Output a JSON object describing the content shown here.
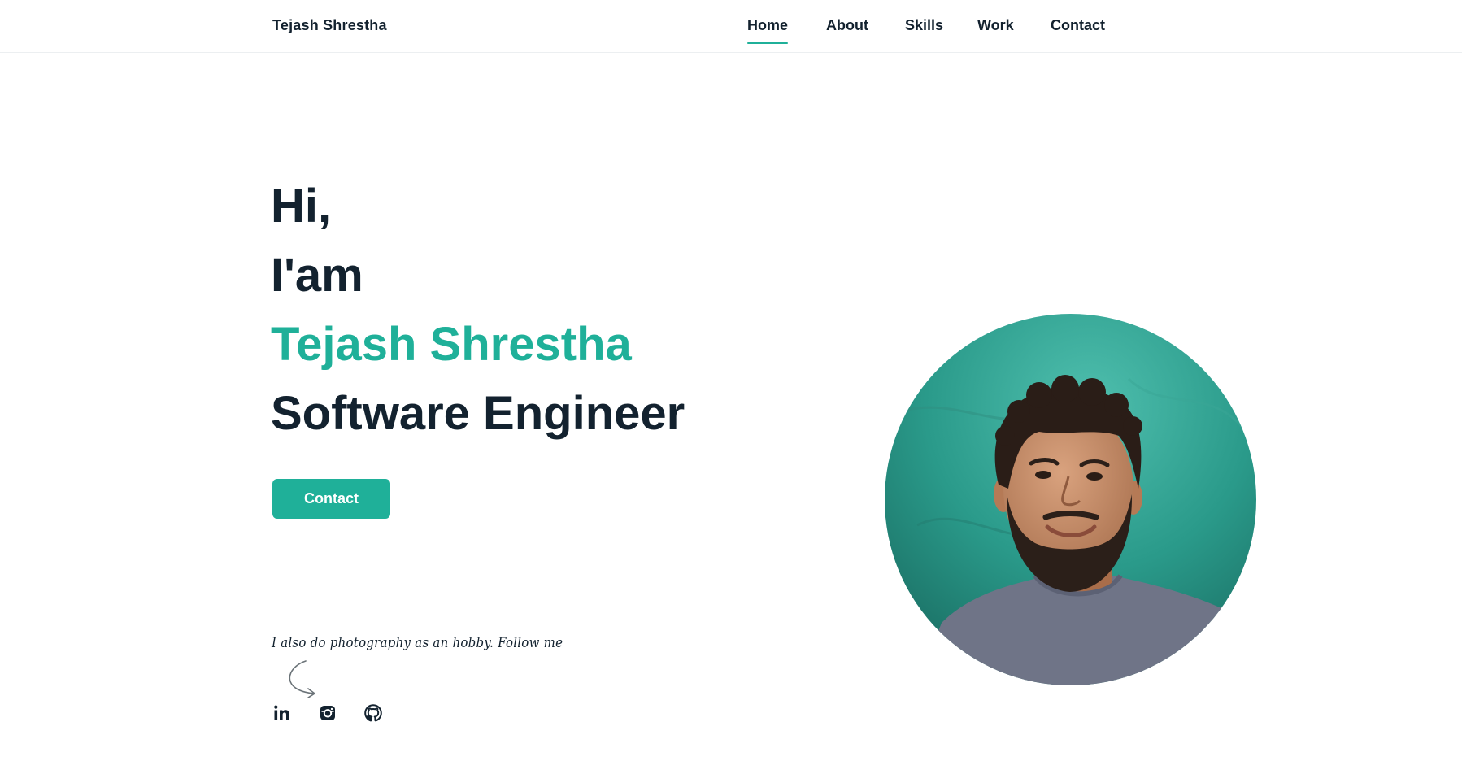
{
  "header": {
    "logo": "Tejash Shrestha",
    "nav": [
      {
        "label": "Home",
        "active": true
      },
      {
        "label": "About",
        "active": false
      },
      {
        "label": "Skills",
        "active": false
      },
      {
        "label": "Work",
        "active": false
      },
      {
        "label": "Contact",
        "active": false
      }
    ]
  },
  "hero": {
    "greeting": "Hi,",
    "intro": "I'am",
    "name": "Tejash Shrestha",
    "title": "Software Engineer",
    "cta_label": "Contact"
  },
  "hobby": {
    "text": "I also do photography as an hobby. Follow me"
  },
  "social": [
    {
      "icon": "linkedin-icon"
    },
    {
      "icon": "instagram-icon"
    },
    {
      "icon": "github-icon"
    }
  ],
  "portrait": {
    "icon": "profile-photo"
  },
  "colors": {
    "accent": "#1fb099",
    "text": "#13222f",
    "background": "#ffffff"
  }
}
